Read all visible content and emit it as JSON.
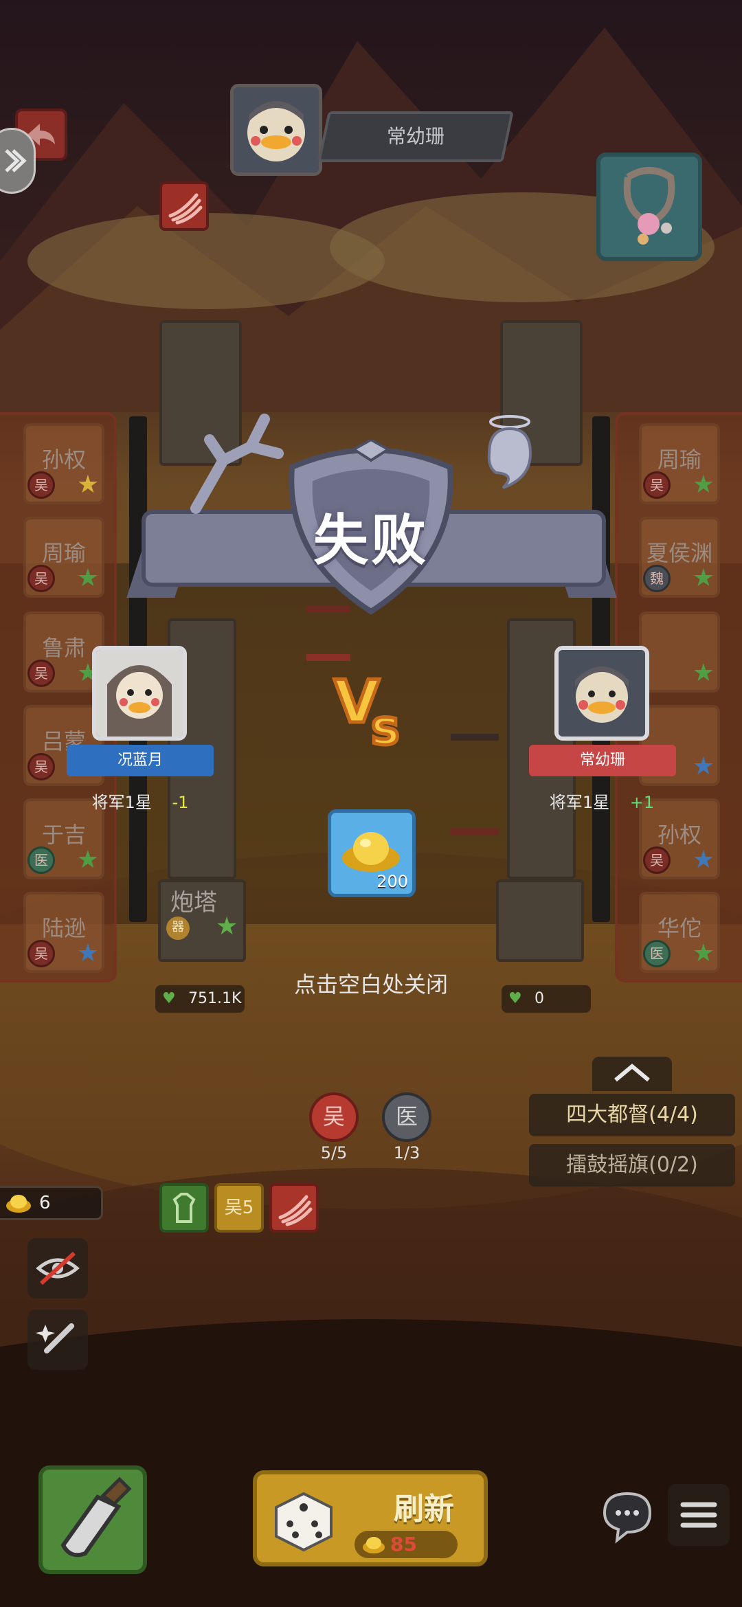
{
  "opponent_top": {
    "name": "常幼珊"
  },
  "left_heroes": [
    {
      "name": "孙权",
      "faction": "吴",
      "star": "gold"
    },
    {
      "name": "周瑜",
      "faction": "吴",
      "star": "green"
    },
    {
      "name": "鲁肃",
      "faction": "吴",
      "star": "green"
    },
    {
      "name": "吕蒙",
      "faction": "吴",
      "star": "green"
    },
    {
      "name": "于吉",
      "faction": "医",
      "star": "green"
    },
    {
      "name": "陆逊",
      "faction": "吴",
      "star": "blue"
    }
  ],
  "right_heroes": [
    {
      "name": "周瑜",
      "faction": "吴",
      "star": "green"
    },
    {
      "name": "夏侯渊",
      "faction": "魏",
      "star": "green"
    },
    {
      "name": "",
      "faction": "",
      "star": "green"
    },
    {
      "name": "",
      "faction": "",
      "star": "blue"
    },
    {
      "name": "孙权",
      "faction": "吴",
      "star": "blue"
    },
    {
      "name": "华佗",
      "faction": "医",
      "star": "green"
    }
  ],
  "towers": {
    "left": {
      "name": "炮塔",
      "faction": "器",
      "hp": "751.1K"
    },
    "right": {
      "hp": "0"
    }
  },
  "result": {
    "title": "失败",
    "vs": "VS"
  },
  "player_left": {
    "name": "况蓝月",
    "rank": "将军1星",
    "delta": "-1",
    "color": "#2f6fbf"
  },
  "player_right": {
    "name": "常幼珊",
    "rank": "将军1星",
    "delta": "+1",
    "color": "#c64545"
  },
  "reward": {
    "icon": "gold-ingot-icon",
    "amount": "200"
  },
  "close_hint": "点击空白处关闭",
  "factions": [
    {
      "label": "吴",
      "count": "5/5",
      "color": "#b63a30"
    },
    {
      "label": "医",
      "count": "1/3",
      "color": "#5a5d63"
    }
  ],
  "bonds": [
    {
      "label": "四大都督(4/4)"
    },
    {
      "label": "擂鼓摇旗(0/2)"
    }
  ],
  "coins": "6",
  "bond_icons": [
    {
      "icon": "tower-icon",
      "color": "#4f8a3a",
      "text": ""
    },
    {
      "icon": "wu-faction-icon",
      "color": "#c49a2a",
      "text": "吴5"
    },
    {
      "icon": "claw-icon",
      "color": "#a8342a",
      "text": ""
    }
  ],
  "refresh": {
    "label": "刷新",
    "cost": "85"
  }
}
